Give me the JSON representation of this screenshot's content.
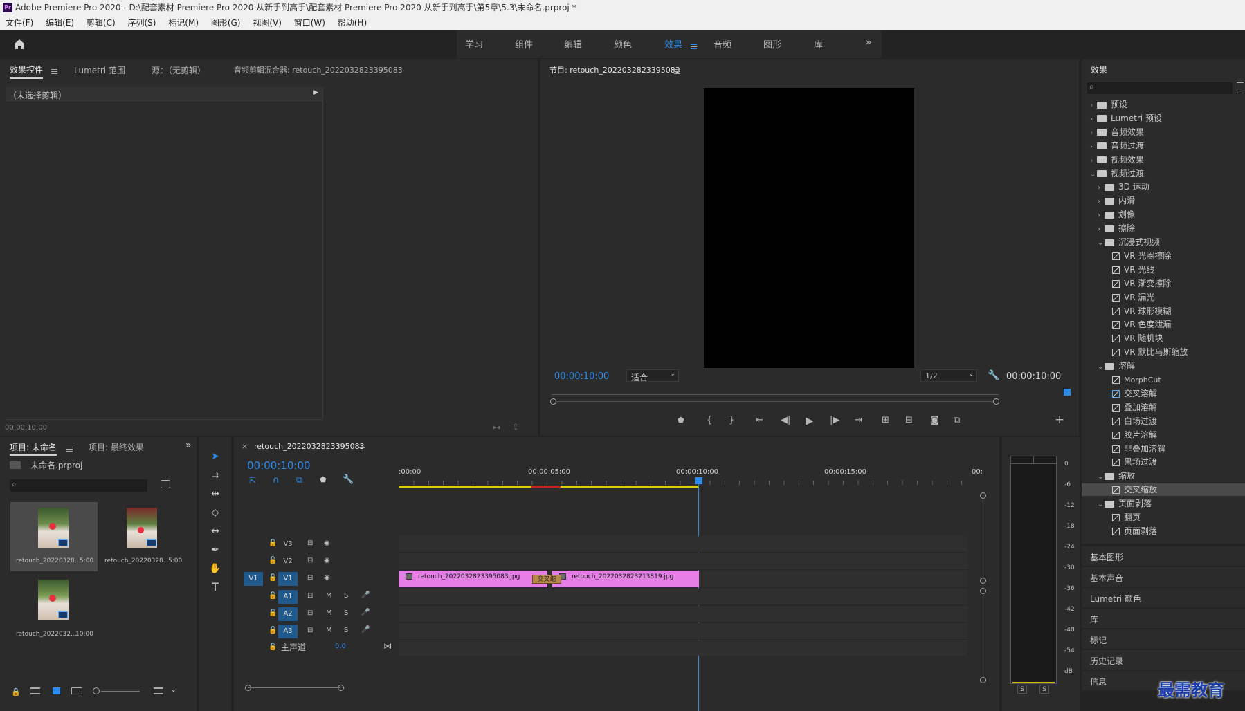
{
  "window": {
    "title": "Adobe Premiere Pro 2020 - D:\\配套素材 Premiere Pro 2020 从新手到高手\\配套素材 Premiere Pro 2020 从新手到高手\\第5章\\5.3\\未命名.prproj *",
    "app_badge": "Pr"
  },
  "menu": [
    "文件(F)",
    "编辑(E)",
    "剪辑(C)",
    "序列(S)",
    "标记(M)",
    "图形(G)",
    "视图(V)",
    "窗口(W)",
    "帮助(H)"
  ],
  "workspaces": {
    "tabs": [
      "学习",
      "组件",
      "编辑",
      "颜色",
      "效果",
      "音频",
      "图形",
      "库"
    ],
    "active": "效果",
    "more": "»"
  },
  "source_panel": {
    "tabs": [
      "效果控件",
      "Lumetri 范围",
      "源：（无剪辑）",
      "音频剪辑混合器: retouch_2022032823395083"
    ],
    "active_tab": "效果控件",
    "no_clip": "（未选择剪辑）",
    "timecode": "00:00:10:00"
  },
  "program_monitor": {
    "title": "节目: retouch_2022032823395083",
    "timecode_left": "00:00:10:00",
    "fit_label": "适合",
    "resolution": "1/2",
    "timecode_right": "00:00:10:00"
  },
  "effects_panel": {
    "title": "效果",
    "search_placeholder": "",
    "tree": [
      {
        "label": "预设",
        "level": 0,
        "type": "folder-star",
        "expanded": false
      },
      {
        "label": "Lumetri 预设",
        "level": 0,
        "type": "folder-star",
        "expanded": false
      },
      {
        "label": "音频效果",
        "level": 0,
        "type": "folder",
        "expanded": false
      },
      {
        "label": "音频过渡",
        "level": 0,
        "type": "folder",
        "expanded": false
      },
      {
        "label": "视频效果",
        "level": 0,
        "type": "folder",
        "expanded": false
      },
      {
        "label": "视频过渡",
        "level": 0,
        "type": "folder",
        "expanded": true
      },
      {
        "label": "3D 运动",
        "level": 1,
        "type": "folder",
        "expanded": false
      },
      {
        "label": "内滑",
        "level": 1,
        "type": "folder",
        "expanded": false
      },
      {
        "label": "划像",
        "level": 1,
        "type": "folder",
        "expanded": false
      },
      {
        "label": "擦除",
        "level": 1,
        "type": "folder",
        "expanded": false
      },
      {
        "label": "沉浸式视频",
        "level": 1,
        "type": "folder",
        "expanded": true
      },
      {
        "label": "VR 光圈擦除",
        "level": 2,
        "type": "fx"
      },
      {
        "label": "VR 光线",
        "level": 2,
        "type": "fx"
      },
      {
        "label": "VR 渐变擦除",
        "level": 2,
        "type": "fx"
      },
      {
        "label": "VR 漏光",
        "level": 2,
        "type": "fx"
      },
      {
        "label": "VR 球形模糊",
        "level": 2,
        "type": "fx"
      },
      {
        "label": "VR 色度泄漏",
        "level": 2,
        "type": "fx"
      },
      {
        "label": "VR 随机块",
        "level": 2,
        "type": "fx"
      },
      {
        "label": "VR 默比乌斯缩放",
        "level": 2,
        "type": "fx"
      },
      {
        "label": "溶解",
        "level": 1,
        "type": "folder",
        "expanded": true
      },
      {
        "label": "MorphCut",
        "level": 2,
        "type": "fx"
      },
      {
        "label": "交叉溶解",
        "level": 2,
        "type": "fx",
        "boxed": true
      },
      {
        "label": "叠加溶解",
        "level": 2,
        "type": "fx"
      },
      {
        "label": "白场过渡",
        "level": 2,
        "type": "fx"
      },
      {
        "label": "胶片溶解",
        "level": 2,
        "type": "fx"
      },
      {
        "label": "非叠加溶解",
        "level": 2,
        "type": "fx"
      },
      {
        "label": "黑场过渡",
        "level": 2,
        "type": "fx"
      },
      {
        "label": "缩放",
        "level": 1,
        "type": "folder",
        "expanded": true
      },
      {
        "label": "交叉缩放",
        "level": 2,
        "type": "fx",
        "selected": true
      },
      {
        "label": "页面剥落",
        "level": 1,
        "type": "folder",
        "expanded": true
      },
      {
        "label": "翻页",
        "level": 2,
        "type": "fx"
      },
      {
        "label": "页面剥落",
        "level": 2,
        "type": "fx"
      }
    ],
    "side_panels": [
      "基本图形",
      "基本声音",
      "Lumetri 颜色",
      "库",
      "标记",
      "历史记录",
      "信息"
    ]
  },
  "project_panel": {
    "tabs": [
      "项目: 未命名",
      "项目: 最终效果"
    ],
    "active_tab": "项目: 未命名",
    "file": "未命名.prproj",
    "clips": [
      {
        "name": "retouch_20220328...",
        "duration": "5:00"
      },
      {
        "name": "retouch_20220328...",
        "duration": "5:00"
      },
      {
        "name": "retouch_2022032...",
        "duration": "10:00"
      }
    ]
  },
  "timeline": {
    "sequence": "retouch_2022032823395083",
    "timecode": "00:00:10:00",
    "ruler": [
      ":00:00",
      "00:00:05:00",
      "00:00:10:00",
      "00:00:15:00",
      "00:"
    ],
    "tracks": [
      {
        "name": "V3",
        "kind": "video"
      },
      {
        "name": "V2",
        "kind": "video"
      },
      {
        "name": "V1",
        "kind": "video",
        "source": "V1"
      },
      {
        "name": "A1",
        "kind": "audio",
        "m": "M",
        "s": "S"
      },
      {
        "name": "A2",
        "kind": "audio",
        "m": "M",
        "s": "S"
      },
      {
        "name": "A3",
        "kind": "audio",
        "m": "M",
        "s": "S"
      }
    ],
    "master": {
      "label": "主声道",
      "value": "0.0"
    },
    "clips": [
      {
        "name": "retouch_2022032823395083.jpg"
      },
      {
        "name": "retouch_2022032823213819.jpg"
      }
    ],
    "transition": "交叉缩"
  },
  "meter": {
    "scale": [
      "0",
      "-6",
      "-12",
      "-18",
      "-24",
      "-30",
      "-36",
      "-42",
      "-48",
      "-54",
      "dB"
    ],
    "solo": [
      "S",
      "S"
    ]
  },
  "watermark": "最需教育",
  "colors": {
    "accent": "#2d8ceb",
    "clip": "#e57ee5",
    "yellow_bar": "#d8d000",
    "red_bar": "#c82020"
  }
}
